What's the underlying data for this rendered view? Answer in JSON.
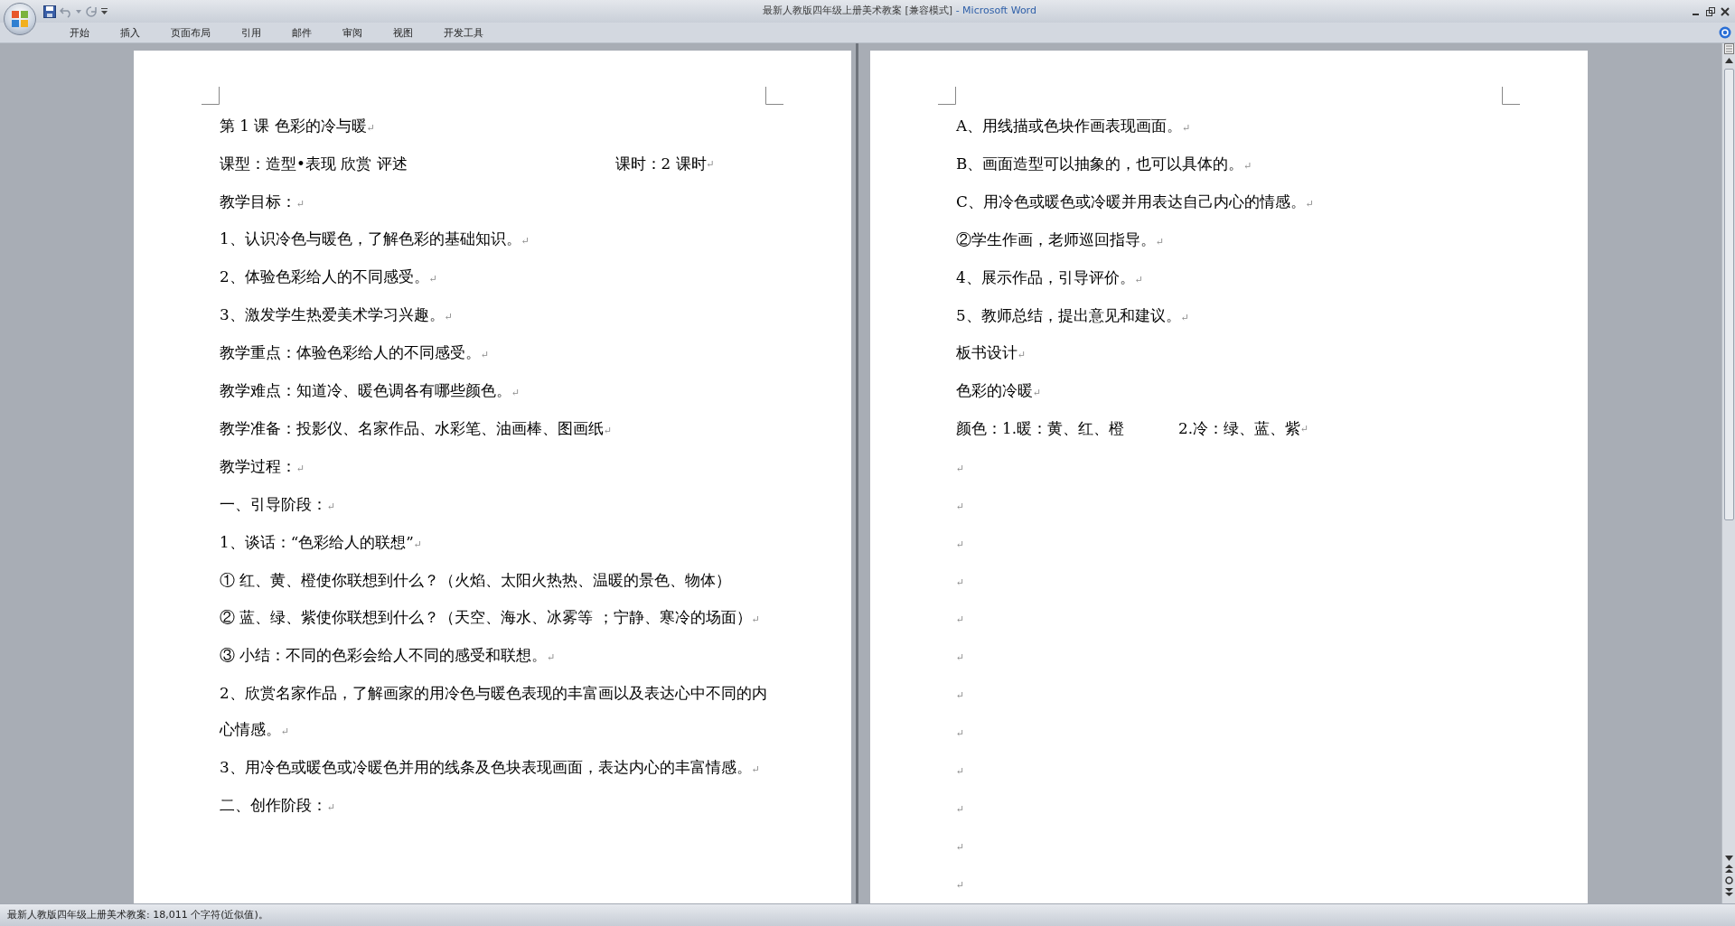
{
  "window": {
    "title": "最新人教版四年级上册美术教案 [兼容模式]",
    "app": "- Microsoft Word"
  },
  "ribbon_tabs": [
    {
      "label": "开始",
      "selected": false
    },
    {
      "label": "插入",
      "selected": false
    },
    {
      "label": "页面布局",
      "selected": false
    },
    {
      "label": "引用",
      "selected": false
    },
    {
      "label": "邮件",
      "selected": false
    },
    {
      "label": "审阅",
      "selected": false
    },
    {
      "label": "视图",
      "selected": false
    },
    {
      "label": "开发工具",
      "selected": false
    }
  ],
  "pages": [
    {
      "paragraphs": [
        {
          "text": "第 1 课 色彩的冷与暖",
          "mark": "↵"
        },
        {
          "text": "课型：造型•表现  欣赏 评述",
          "text_right": "课时：2 课时",
          "mark": "↵"
        },
        {
          "text": "教学目标：",
          "mark": "↵"
        },
        {
          "text": "1、认识冷色与暖色，了解色彩的基础知识。",
          "mark": "↵"
        },
        {
          "text": "2、体验色彩给人的不同感受。",
          "mark": "↵"
        },
        {
          "text": "3、激发学生热爱美术学习兴趣。",
          "mark": "↵"
        },
        {
          "text": "教学重点：体验色彩给人的不同感受。",
          "mark": "↵"
        },
        {
          "text": "教学难点：知道冷、暖色调各有哪些颜色。",
          "mark": "↵"
        },
        {
          "text": "教学准备：投影仪、名家作品、水彩笔、油画棒、图画纸",
          "mark": "↵"
        },
        {
          "text": "教学过程：",
          "mark": "↵"
        },
        {
          "text": "一、引导阶段：",
          "mark": "↵"
        },
        {
          "text": "1、谈话：“色彩给人的联想”",
          "mark": "↵"
        },
        {
          "text": "① 红、黄、橙使你联想到什么？（火焰、太阳火热热、温暖的景色、物体）"
        },
        {
          "text": "② 蓝、绿、紫使你联想到什么？（天空、海水、冰雾等 ；宁静、寒冷的场面）",
          "mark": "↵"
        },
        {
          "text": "③ 小结：不同的色彩会给人不同的感受和联想。",
          "mark": "↵"
        },
        {
          "text": "2、欣赏名家作品，了解画家的用冷色与暖色表现的丰富画以及表达心中不同的内心情感。",
          "mark": "↵"
        },
        {
          "text": "3、用冷色或暖色或冷暖色并用的线条及色块表现画面，表达内心的丰富情感。",
          "mark": "↵"
        },
        {
          "text": "二、创作阶段：",
          "mark": "↵"
        }
      ]
    },
    {
      "paragraphs": [
        {
          "text": "A、用线描或色块作画表现画面。",
          "mark": "↵"
        },
        {
          "text": "B、画面造型可以抽象的，也可以具体的。",
          "mark": "↵"
        },
        {
          "text": "C、用冷色或暖色或冷暖并用表达自己内心的情感。",
          "mark": "↵"
        },
        {
          "text": "②学生作画，老师巡回指导。",
          "mark": "↵"
        },
        {
          "text": "4、展示作品，引导评价。",
          "mark": "↵"
        },
        {
          "text": "5、教师总结，提出意见和建议。",
          "mark": "↵"
        },
        {
          "text": "板书设计",
          "mark": "↵"
        },
        {
          "text": "色彩的冷暖",
          "mark": "↵"
        },
        {
          "text": "颜色：1.暖：黄、红、橙",
          "text_right": "2.冷：绿、蓝、紫",
          "mark": "↵"
        },
        {
          "mark": "↵"
        },
        {
          "mark": "↵"
        },
        {
          "mark": "↵"
        },
        {
          "mark": "↵"
        },
        {
          "mark": "↵"
        },
        {
          "mark": "↵"
        },
        {
          "mark": "↵"
        },
        {
          "mark": "↵"
        },
        {
          "mark": "↵"
        },
        {
          "mark": "↵"
        },
        {
          "mark": "↵"
        },
        {
          "mark": "↵"
        }
      ]
    }
  ],
  "status_bar": {
    "text": "最新人教版四年级上册美术教案: 18,011 个字符(近似值)。"
  }
}
